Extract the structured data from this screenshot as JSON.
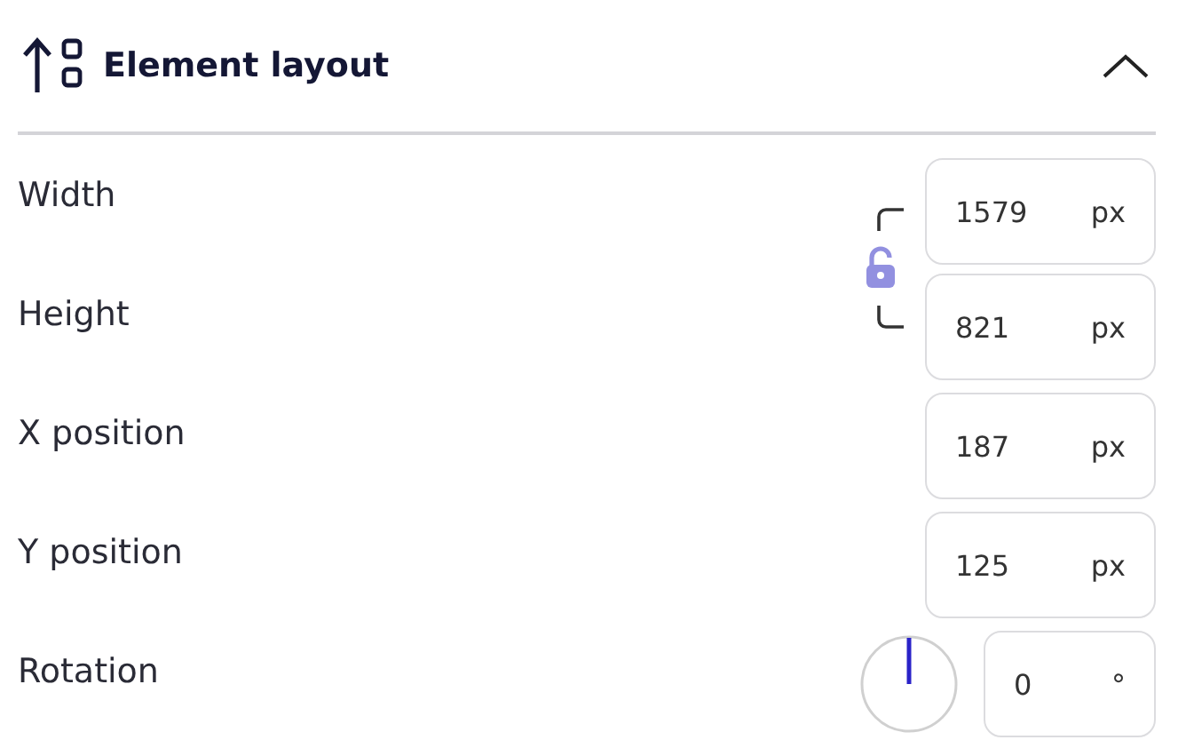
{
  "section": {
    "title": "Element layout",
    "expanded": true
  },
  "aspect_lock": {
    "locked": false
  },
  "fields": [
    {
      "kind": "size",
      "label": "Width",
      "value": "1579",
      "unit": "px"
    },
    {
      "kind": "size",
      "label": "Height",
      "value": "821",
      "unit": "px"
    },
    {
      "kind": "plain",
      "label": "X position",
      "value": "187",
      "unit": "px"
    },
    {
      "kind": "plain",
      "label": "Y position",
      "value": "125",
      "unit": "px"
    },
    {
      "kind": "angle",
      "label": "Rotation",
      "value": "0",
      "unit": "°"
    }
  ]
}
